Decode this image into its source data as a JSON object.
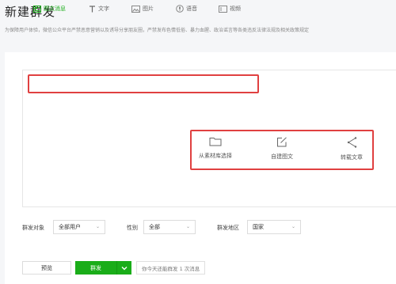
{
  "page": {
    "title": "新建群发",
    "notice": "为保障用户体验，微信公众平台严禁恶意营销以及诱导分享朋友圈，严禁发布色情低俗、暴力血腥、政治谣言等各类违反法律法规及相关政策规定"
  },
  "tabs": [
    {
      "label": "图文消息",
      "icon": "news-icon",
      "active": true
    },
    {
      "label": "文字",
      "icon": "text-icon",
      "active": false
    },
    {
      "label": "图片",
      "icon": "image-icon",
      "active": false
    },
    {
      "label": "语音",
      "icon": "audio-icon",
      "active": false
    },
    {
      "label": "视频",
      "icon": "video-icon",
      "active": false
    }
  ],
  "actions": [
    {
      "label": "从素材库选择",
      "icon": "folder-icon"
    },
    {
      "label": "自建图文",
      "icon": "edit-icon"
    },
    {
      "label": "转载文章",
      "icon": "share-icon"
    }
  ],
  "filters": {
    "target_label": "群发对象",
    "target_value": "全部用户",
    "gender_label": "性别",
    "gender_value": "全部",
    "region_label": "群发地区",
    "region_value": "国家"
  },
  "footer": {
    "preview_label": "预览",
    "send_label": "群发",
    "quota_text": "你今天还能群发 1 次消息"
  },
  "colors": {
    "accent": "#1aad19",
    "highlight": "#e04040"
  }
}
